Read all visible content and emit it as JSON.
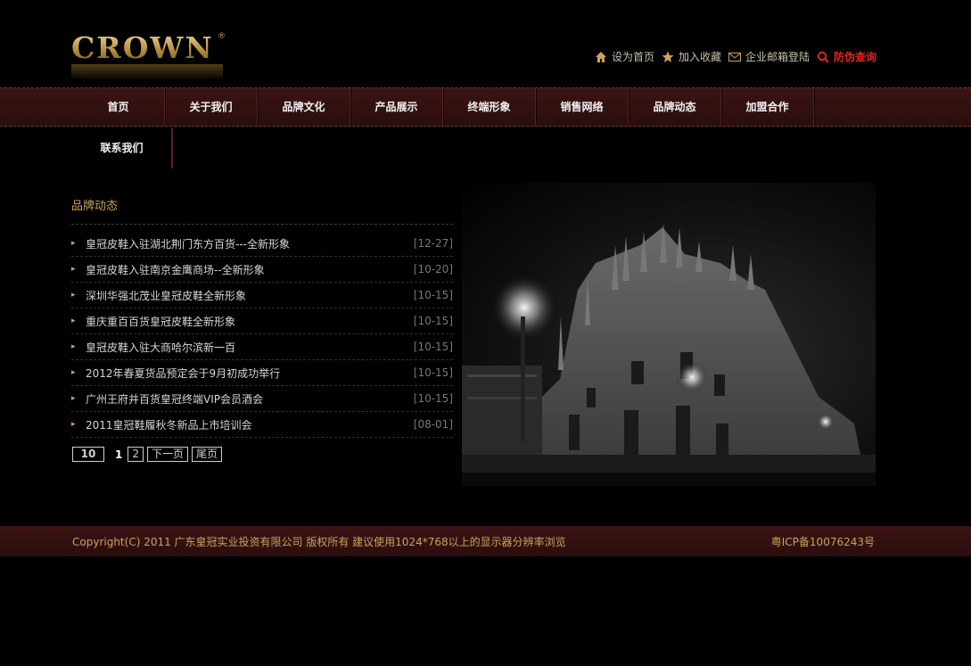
{
  "logo": {
    "text": "CROWN",
    "reg": "®"
  },
  "toplinks": [
    {
      "label": "设为首页",
      "icon": "home-icon"
    },
    {
      "label": "加入收藏",
      "icon": "star-icon"
    },
    {
      "label": "企业邮箱登陆",
      "icon": "mail-icon"
    },
    {
      "label": "防伪查询",
      "icon": "search-icon"
    }
  ],
  "nav": {
    "items": [
      "首页",
      "关于我们",
      "品牌文化",
      "产品展示",
      "终端形象",
      "销售网络",
      "品牌动态",
      "加盟合作"
    ],
    "row2": [
      "联系我们"
    ]
  },
  "section": {
    "title": "品牌动态"
  },
  "news": [
    {
      "title": "皇冠皮鞋入驻湖北荆门东方百货---全新形象",
      "date": "[12-27]"
    },
    {
      "title": "皇冠皮鞋入驻南京金鹰商场--全新形象",
      "date": "[10-20]"
    },
    {
      "title": "深圳华强北茂业皇冠皮鞋全新形象",
      "date": "[10-15]"
    },
    {
      "title": "重庆重百百货皇冠皮鞋全新形象",
      "date": "[10-15]"
    },
    {
      "title": "皇冠皮鞋入驻大商哈尔滨新一百",
      "date": "[10-15]"
    },
    {
      "title": "2012年春夏货品预定会于9月初成功举行",
      "date": "[10-15]"
    },
    {
      "title": "广州王府井百货皇冠终端VIP会员酒会",
      "date": "[10-15]"
    },
    {
      "title": "2011皇冠鞋履秋冬新品上市培训会",
      "date": "[08-01]"
    }
  ],
  "pager": {
    "count": "10",
    "current": "1",
    "page2": "2",
    "next": "下一页",
    "last": "尾页"
  },
  "footer": {
    "copyright": "Copyright(C) 2011 广东皇冠实业投资有限公司 版权所有 建议使用1024*768以上的显示器分辨率浏览",
    "icp": "粤ICP备10076243号"
  },
  "colors": {
    "accent": "#c9a35a",
    "nav_bg": "#2a0d0d",
    "alert": "#e0251b"
  }
}
